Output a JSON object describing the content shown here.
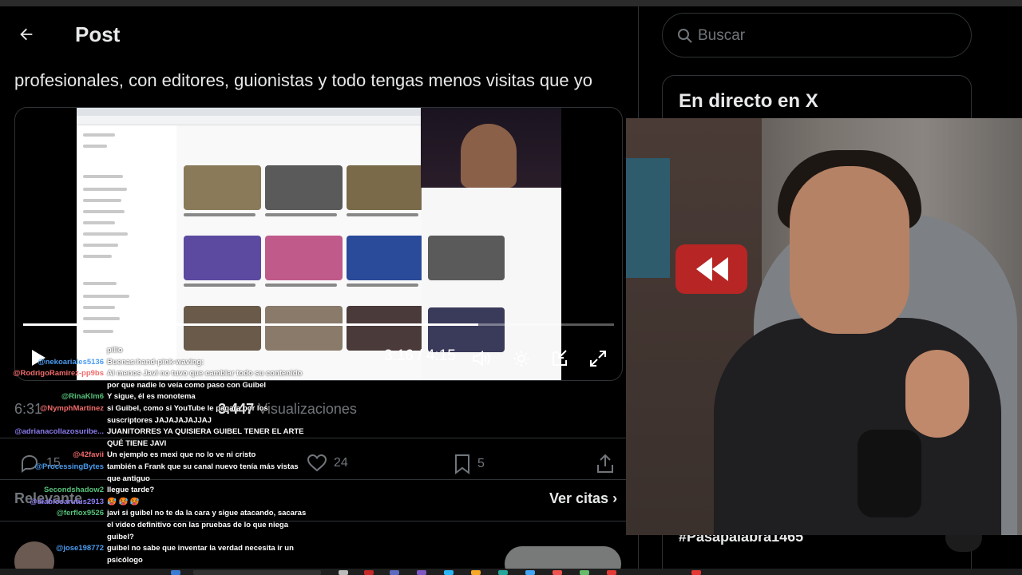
{
  "header": {
    "title": "Post"
  },
  "post": {
    "text": "profesionales, con editores, guionistas y todo tengas menos visitas que yo",
    "video": {
      "time": "3:16 / 4:15",
      "progress": 0.77
    },
    "meta": {
      "time": "6:31",
      "views_count": "3.447",
      "views_label": "Visualizaciones"
    },
    "actions": {
      "replies": "15",
      "likes": "24",
      "bookmarks": "5"
    },
    "replies_filter": "Relevante",
    "quotes_link": "Ver citas"
  },
  "sidebar": {
    "search_placeholder": "Buscar",
    "live_title": "En directo en X",
    "hashtag": "#Pasapalabra1465"
  },
  "chat": [
    {
      "user": "",
      "color": "#ffffff",
      "msg": "pillo"
    },
    {
      "user": "@nekoariales5136",
      "color": "#4a9cf0",
      "msg": "Buenas:hand-pink-waving:"
    },
    {
      "user": "@RodrigoRamirez-pp9bs",
      "color": "#f26b6b",
      "msg": "Al menos Javi no tuvo que cambiar todo su contenido"
    },
    {
      "user": "",
      "color": "#ffffff",
      "msg": "por que nadie lo veía como paso con Guibel"
    },
    {
      "user": "@RinaKlm6",
      "color": "#55c27a",
      "msg": "Y sigue, él es monotema"
    },
    {
      "user": "@NymphMartinez",
      "color": "#f26b6b",
      "msg": "si Guibel, como si YouTube le pagara por los"
    },
    {
      "user": "",
      "color": "#ffffff",
      "msg": "suscriptores JAJAJAJAJJAJ"
    },
    {
      "user": "@adrianacollazosuribe...",
      "color": "#8c7cf0",
      "msg": "JUANITORRES YA QUISIERA GUIBEL TENER EL ARTE"
    },
    {
      "user": "",
      "color": "#ffffff",
      "msg": "QUÉ TIENE JAVI"
    },
    {
      "user": "@42favii",
      "color": "#f26b6b",
      "msg": "Un ejemplo es mexi que no lo ve ni cristo"
    },
    {
      "user": "@ProcessingBytes",
      "color": "#4a9cf0",
      "msg": "también a Frank que su canal nuevo tenía más vistas"
    },
    {
      "user": "",
      "color": "#ffffff",
      "msg": "que antiguo"
    },
    {
      "user": "Secondshadow2",
      "color": "#55c27a",
      "msg": "llegue tarde?"
    },
    {
      "user": "@diablosarutus2913",
      "color": "#8c7cf0",
      "msg": "🥵 🥵 🥵"
    },
    {
      "user": "@ferflox9526",
      "color": "#55c27a",
      "msg": "javi si guibel no te da la cara y sigue atacando, sacaras"
    },
    {
      "user": "",
      "color": "#ffffff",
      "msg": "el video definitivo con las pruebas de lo que niega"
    },
    {
      "user": "",
      "color": "#ffffff",
      "msg": "guibel?"
    },
    {
      "user": "@jose198772",
      "color": "#4a9cf0",
      "msg": "guibel no sabe que inventar la verdad necesita ir un"
    },
    {
      "user": "",
      "color": "#ffffff",
      "msg": "psicólogo"
    }
  ],
  "icons": {
    "back": "arrow-left-icon",
    "search": "search-icon",
    "play": "play-icon",
    "volume": "volume-icon",
    "settings": "gear-icon",
    "minimize": "minimize-icon",
    "fullscreen": "fullscreen-icon",
    "reply": "reply-icon",
    "like": "heart-icon",
    "bookmark": "bookmark-icon",
    "share": "share-icon",
    "chevron": "chevron-right-icon"
  }
}
